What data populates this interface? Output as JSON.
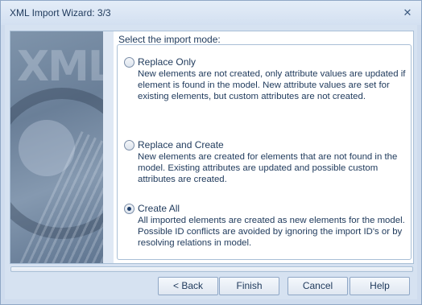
{
  "window": {
    "title": "XML Import Wizard: 3/3",
    "close_icon": "close-icon"
  },
  "side_image": {
    "watermark": "XML"
  },
  "import_mode": {
    "label": "Select the import mode:",
    "selected": "create_all",
    "options": [
      {
        "id": "replace_only",
        "title": "Replace Only",
        "checked": false,
        "description": "New elements are not created, only attribute values are updated if element is found in the model. New attribute values are set for existing elements, but custom attributes are not created."
      },
      {
        "id": "replace_and_create",
        "title": "Replace and Create",
        "checked": false,
        "description": "New elements are created for elements that are not found in the model. Existing attributes are updated and possible custom attributes are created."
      },
      {
        "id": "create_all",
        "title": "Create All",
        "checked": true,
        "description": "All imported elements are created as new elements for the model. Possible ID conflicts are avoided by ignoring the import ID's or by resolving relations in model."
      }
    ]
  },
  "buttons": {
    "back": "< Back",
    "finish": "Finish",
    "cancel": "Cancel",
    "help": "Help"
  },
  "colors": {
    "accent": "#1e395b",
    "window_bg": "#d6e2f1",
    "border": "#8fa7c6"
  }
}
